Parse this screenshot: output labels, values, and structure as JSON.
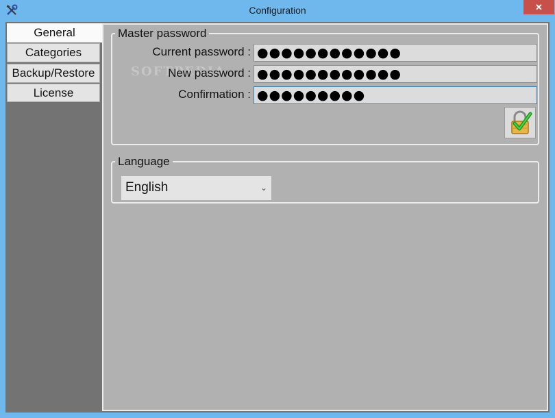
{
  "window": {
    "title": "Configuration",
    "close_glyph": "✕",
    "icon": "tools-icon"
  },
  "sidebar": {
    "tabs": [
      {
        "label": "General",
        "active": true
      },
      {
        "label": "Categories",
        "active": false
      },
      {
        "label": "Backup/Restore",
        "active": false
      },
      {
        "label": "License",
        "active": false
      }
    ]
  },
  "master_password": {
    "legend": "Master password",
    "current_label": "Current password :",
    "current_value": "●●●●●●●●●●●●",
    "new_label": "New password :",
    "new_value": "●●●●●●●●●●●●",
    "confirm_label": "Confirmation :",
    "confirm_value": "●●●●●●●●●",
    "apply_icon": "lock-check-icon"
  },
  "language": {
    "legend": "Language",
    "selected": "English",
    "chevron": "⌄"
  },
  "watermark": "SOFTPEDIA",
  "colors": {
    "titlebar": "#6fb8ee",
    "close_button": "#c7504a",
    "panel_background": "#b1b1b1",
    "sidebar_background": "#737373"
  }
}
